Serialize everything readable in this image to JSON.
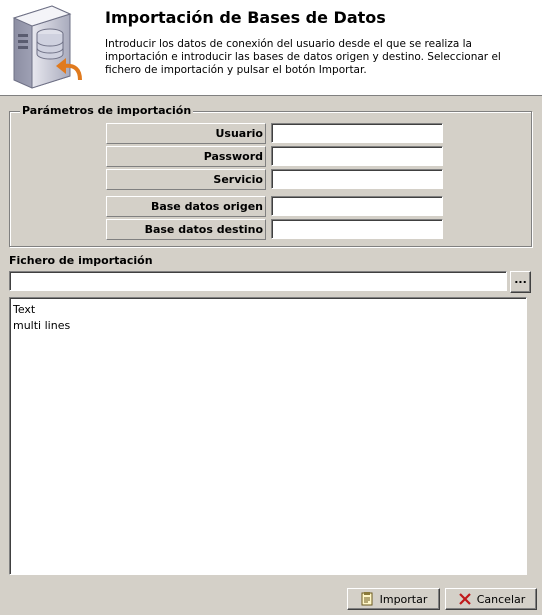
{
  "header": {
    "title": "Importación de Bases de Datos",
    "description": "Introducir los datos de conexión del usuario desde el que se realiza la importación e introducir las bases de datos origen y destino. Seleccionar el fichero de importación y pulsar el botón Importar."
  },
  "params": {
    "legend": "Parámetros de importación",
    "user_label": "Usuario",
    "user_value": "",
    "password_label": "Password",
    "password_value": "",
    "service_label": "Servicio",
    "service_value": "",
    "source_db_label": "Base datos origen",
    "source_db_value": "",
    "target_db_label": "Base datos destino",
    "target_db_value": ""
  },
  "file": {
    "label": "Fichero de importación",
    "path_value": "",
    "browse_label": "..."
  },
  "log": {
    "line1": "Text",
    "line2": "multi lines"
  },
  "buttons": {
    "import_label": "Importar",
    "cancel_label": "Cancelar"
  }
}
